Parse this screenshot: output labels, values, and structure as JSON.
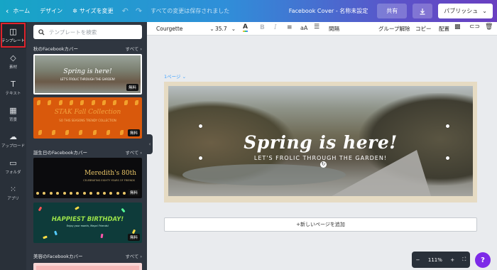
{
  "topbar": {
    "home": "ホーム",
    "design": "デザイン",
    "resize": "サイズを変更",
    "save_status": "すべての変更は保存されました",
    "doc_title": "Facebook Cover - 名称未設定",
    "share": "共有",
    "publish": "パブリッシュ"
  },
  "rail": {
    "templates": "テンプレート",
    "elements": "素材",
    "text": "テキスト",
    "background": "背景",
    "upload": "アップロード",
    "folder": "フォルダ",
    "apps": "アプリ"
  },
  "panel": {
    "search_placeholder": "テンプレートを検索",
    "sections": [
      {
        "title": "秋のFacebookカバー",
        "all": "すべて"
      },
      {
        "title": "誕生日のFacebookカバー",
        "all": "すべて"
      },
      {
        "title": "美容のFacebookカバー",
        "all": "すべて"
      }
    ],
    "free_badge": "無料",
    "thumbs": [
      {
        "title": "Spring is here!",
        "sub": "LET'S FROLIC THROUGH THE GARDEN!"
      },
      {
        "title": "STAK Fall Collection",
        "sub": "SO THIS SEASONS TRENDY COLLECTION"
      },
      {
        "title": "Meredith's 80th",
        "sub": "CELEBRATING EIGHTY YEARS OF FRIENDS"
      },
      {
        "title": "HAPPIEST BIRTHDAY!",
        "sub": "Enjoy your month, Maya! Friends!"
      }
    ]
  },
  "toolbar": {
    "font": "Courgette",
    "size": "35.7",
    "spacing": "間隔",
    "ungroup": "グループ解除",
    "copy": "コピー",
    "arrange": "配置"
  },
  "canvas": {
    "page_label": "1ページ",
    "headline": "Spring is here!",
    "subline": "LET'S FROLIC THROUGH THE GARDEN!",
    "add_page": "+新しいページを追加"
  },
  "zoom": {
    "minus": "−",
    "level": "111%",
    "plus": "+"
  },
  "help": "?",
  "colors": {
    "rail_bg": "#293039",
    "panel_bg": "#2f3640",
    "active_outline": "#e0232b",
    "help_purple": "#7d2ae8",
    "page_label": "#3ca0ff"
  }
}
